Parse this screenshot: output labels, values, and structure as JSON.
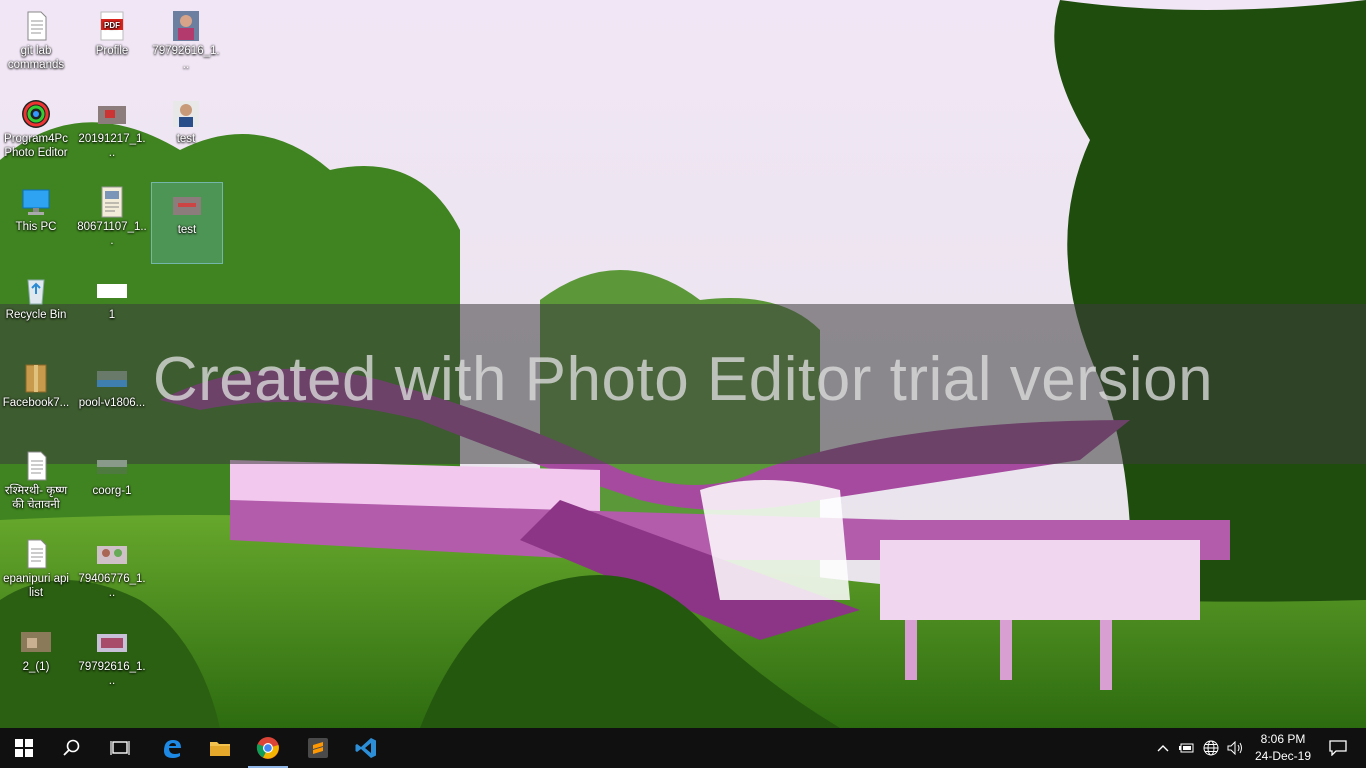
{
  "watermark": {
    "text": "Created with Photo Editor trial version"
  },
  "desktop_icons": [
    {
      "label": "git lab commands",
      "icon": "text-document-icon"
    },
    {
      "label": "Profile",
      "icon": "pdf-file-icon"
    },
    {
      "label": "79792616_1...",
      "icon": "image-file-icon"
    },
    {
      "label": "Program4Pc Photo Editor",
      "icon": "photo-editor-app-icon"
    },
    {
      "label": "20191217_1...",
      "icon": "image-file-icon"
    },
    {
      "label": "test",
      "icon": "image-file-icon"
    },
    {
      "label": "This PC",
      "icon": "computer-icon"
    },
    {
      "label": "80671107_1...",
      "icon": "image-file-icon"
    },
    {
      "label": "test",
      "icon": "image-file-icon"
    },
    {
      "label": "Recycle Bin",
      "icon": "recycle-bin-icon"
    },
    {
      "label": "1",
      "icon": "image-file-icon"
    },
    {
      "label": "Facebook7...",
      "icon": "archive-folder-icon"
    },
    {
      "label": "pool-v1806...",
      "icon": "image-file-icon"
    },
    {
      "label": "रश्मिरथी- कृष्ण की चेतावनी",
      "icon": "text-document-icon"
    },
    {
      "label": "coorg-1",
      "icon": "image-file-icon"
    },
    {
      "label": "epanipuri api list",
      "icon": "text-document-icon"
    },
    {
      "label": "79406776_1...",
      "icon": "image-file-icon"
    },
    {
      "label": "2_(1)",
      "icon": "image-file-icon"
    },
    {
      "label": "79792616_1...",
      "icon": "image-file-icon"
    }
  ],
  "taskbar": {
    "pinned": [
      {
        "name": "start",
        "icon": "windows-logo-icon"
      },
      {
        "name": "search",
        "icon": "search-icon"
      },
      {
        "name": "task-view",
        "icon": "task-view-icon"
      },
      {
        "name": "edge",
        "icon": "edge-browser-icon"
      },
      {
        "name": "file-explorer",
        "icon": "folder-icon"
      },
      {
        "name": "chrome",
        "icon": "chrome-browser-icon"
      },
      {
        "name": "sublime-text",
        "icon": "sublime-text-icon"
      },
      {
        "name": "vscode",
        "icon": "vscode-icon"
      }
    ],
    "clock": {
      "time": "8:06 PM",
      "date": "24-Dec-19"
    },
    "tray": [
      "chevron-up-icon",
      "battery-icon",
      "network-globe-icon",
      "volume-icon",
      "notification-icon"
    ]
  }
}
